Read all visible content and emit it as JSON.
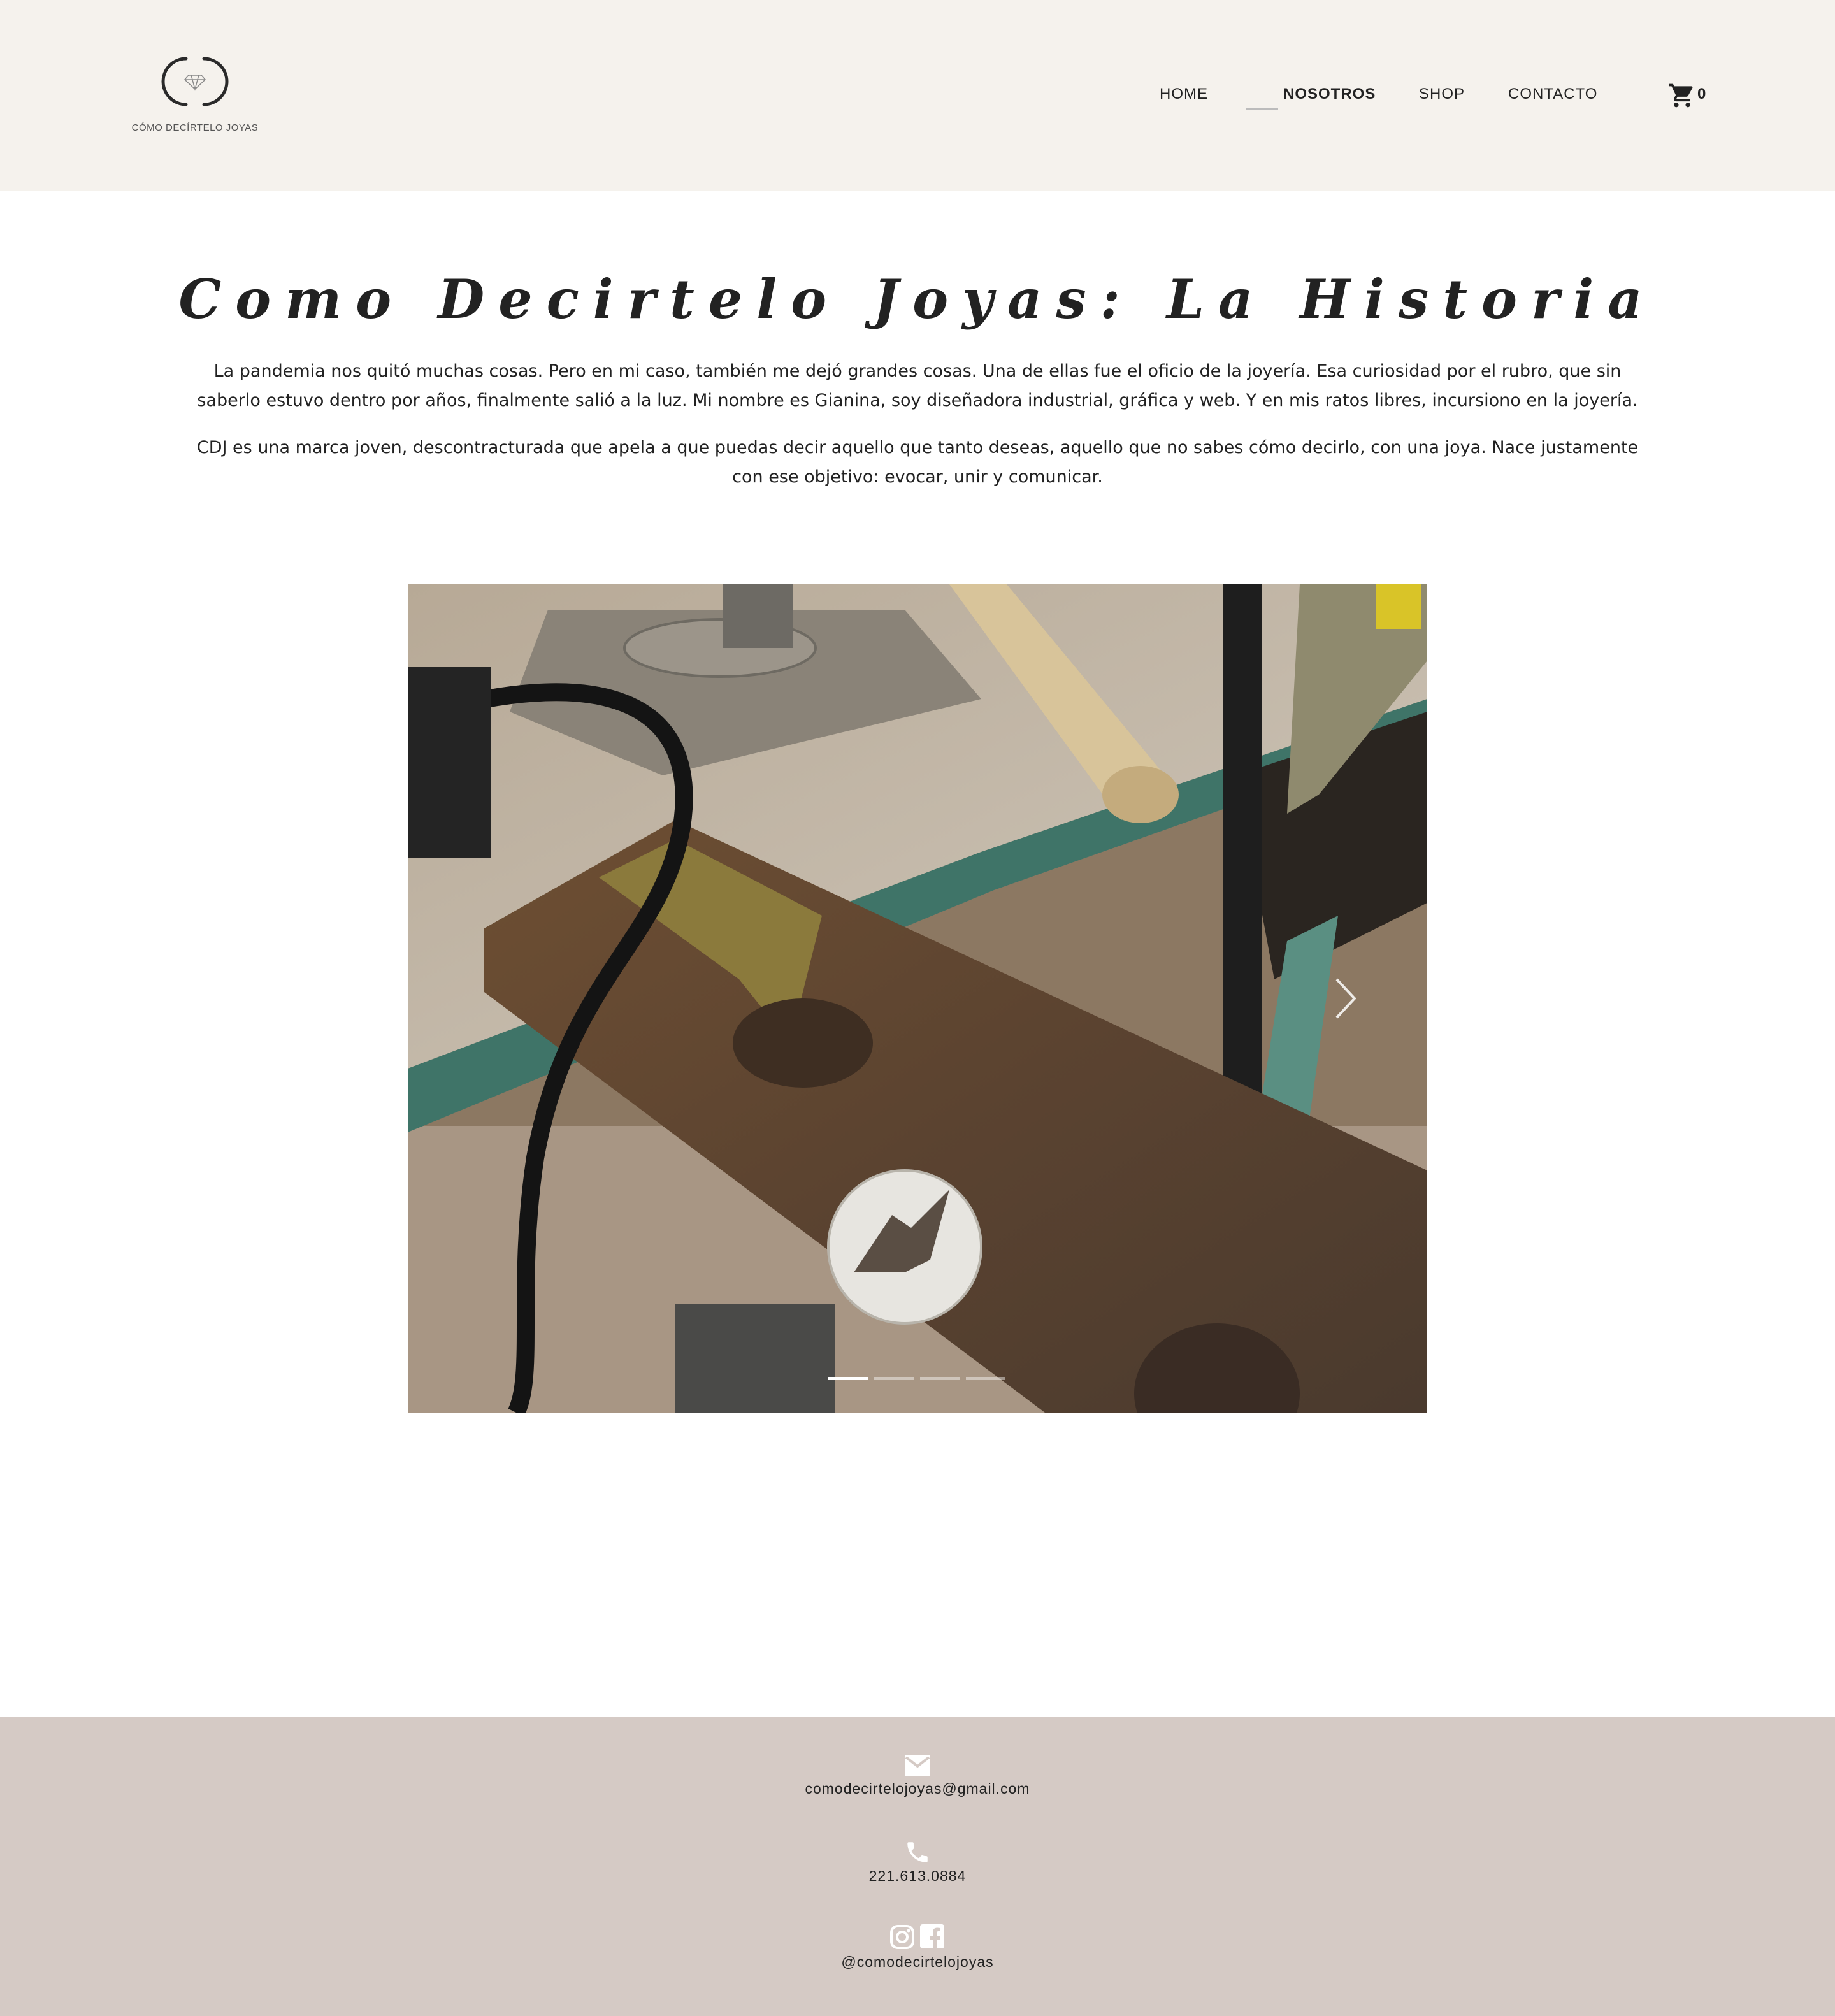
{
  "header": {
    "logo_text": "CÓMO DECÍRTELO JOYAS",
    "nav": {
      "home": "HOME",
      "nosotros": "NOSOTROS",
      "shop": "SHOP",
      "contacto": "CONTACTO"
    },
    "active_nav": "NOSOTROS",
    "cart_count": "0",
    "cart_icon": "cart-icon"
  },
  "main": {
    "title": "Como Decirtelo Joyas: La Historia",
    "paragraphs": [
      "La pandemia nos quitó muchas cosas. Pero en mi caso, también me dejó grandes cosas. Una de ellas fue el oficio de la joyería. Esa curiosidad por el rubro, que sin saberlo estuvo dentro por años, finalmente salió a la luz. Mi nombre es Gianina, soy diseñadora industrial, gráfica y web. Y en mis ratos libres, incursiono en la joyería.",
      "CDJ es una marca joven, descontracturada que apela a que puedas decir aquello que tanto deseas, aquello que no sabes cómo decirlo, con una joya. Nace justamente con ese objetivo: evocar, unir y comunicar."
    ],
    "slider": {
      "slide_count": 4,
      "active_slide": 1,
      "next_icon": "chevron-right-icon"
    }
  },
  "footer": {
    "email": "comodecirtelojoyas@gmail.com",
    "phone": "221.613.0884",
    "social_handle": "@comodecirtelojoyas",
    "icons": [
      "mail-icon",
      "phone-icon",
      "instagram-icon",
      "facebook-icon"
    ]
  },
  "colors": {
    "header_bg": "#f5f2ed",
    "footer_bg": "#d5cac5",
    "text": "#222222"
  }
}
